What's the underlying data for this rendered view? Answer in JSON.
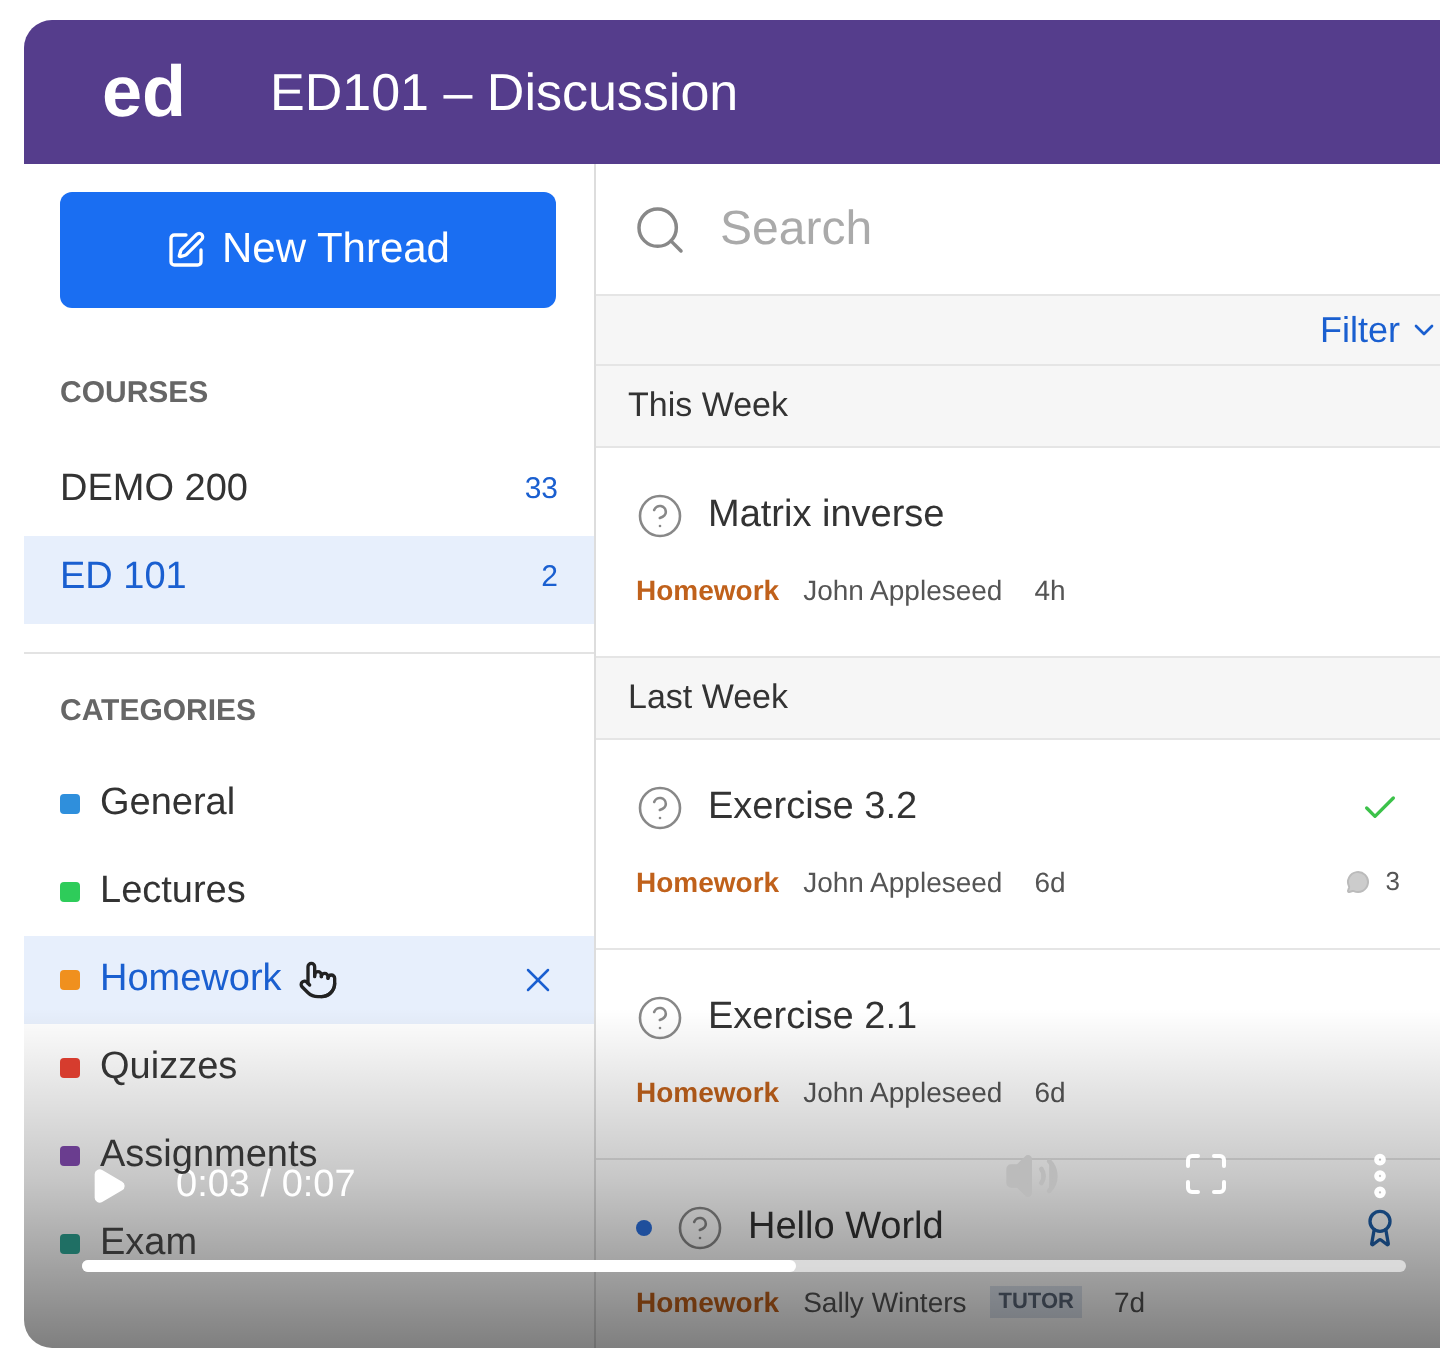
{
  "header": {
    "logo": "ed",
    "title": "ED101 – Discussion"
  },
  "new_thread_button": "New Thread",
  "courses": {
    "heading": "COURSES",
    "items": [
      {
        "name": "DEMO 200",
        "count": "33",
        "selected": false
      },
      {
        "name": "ED 101",
        "count": "2",
        "selected": true
      }
    ]
  },
  "categories": {
    "heading": "CATEGORIES",
    "items": [
      {
        "name": "General",
        "color": "#2f8fdc",
        "selected": false
      },
      {
        "name": "Lectures",
        "color": "#2ecc5a",
        "selected": false
      },
      {
        "name": "Homework",
        "color": "#f0901e",
        "selected": true
      },
      {
        "name": "Quizzes",
        "color": "#d63c2e",
        "selected": false
      },
      {
        "name": "Assignments",
        "color": "#6a3d8f",
        "selected": false
      },
      {
        "name": "Exam",
        "color": "#1f6f64",
        "selected": false
      }
    ]
  },
  "search": {
    "placeholder": "Search"
  },
  "filter": "Filter",
  "groups": [
    {
      "heading": "This Week",
      "threads": [
        {
          "title": "Matrix inverse",
          "category": "Homework",
          "author": "John Appleseed",
          "time": "4h",
          "answered": false,
          "unread": false
        }
      ]
    },
    {
      "heading": "Last Week",
      "threads": [
        {
          "title": "Exercise 3.2",
          "category": "Homework",
          "author": "John Appleseed",
          "time": "6d",
          "answered": true,
          "unread": false,
          "comments": "3"
        },
        {
          "title": "Exercise 2.1",
          "category": "Homework",
          "author": "John Appleseed",
          "time": "6d",
          "answered": false,
          "unread": false
        },
        {
          "title": "Hello World",
          "category": "Homework",
          "author": "Sally Winters",
          "badge": "TUTOR",
          "time": "7d",
          "answered": false,
          "unread": true,
          "award": true
        }
      ]
    }
  ],
  "player": {
    "time": "0:03 / 0:07",
    "level": 0.54
  }
}
